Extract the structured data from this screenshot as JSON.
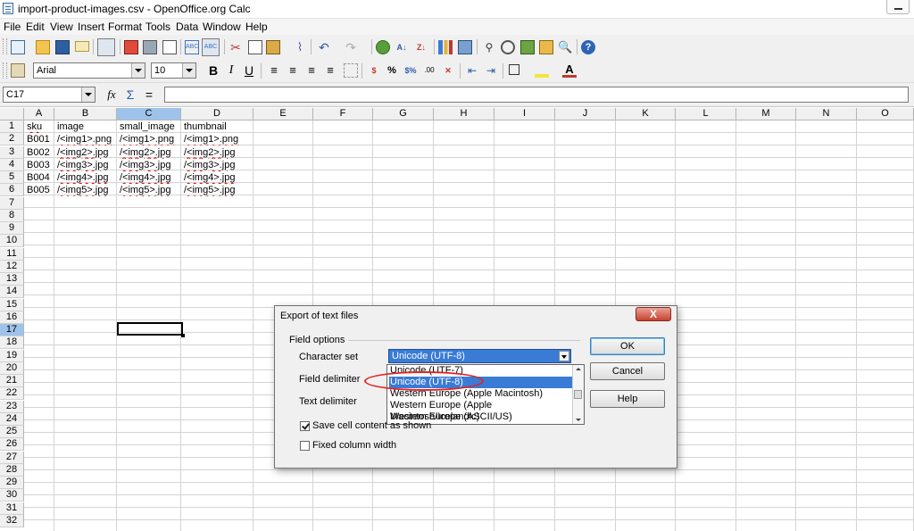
{
  "window": {
    "title": "import-product-images.csv - OpenOffice.org Calc"
  },
  "menu": [
    "File",
    "Edit",
    "View",
    "Insert",
    "Format",
    "Tools",
    "Data",
    "Window",
    "Help"
  ],
  "format_bar": {
    "font_name": "Arial",
    "font_size": "10"
  },
  "formula_bar": {
    "cell_ref": "C17",
    "content": ""
  },
  "sheet": {
    "columns": [
      "A",
      "B",
      "C",
      "D",
      "E",
      "F",
      "G",
      "H",
      "I",
      "J",
      "K",
      "L",
      "M",
      "N",
      "O"
    ],
    "selected_column": "C",
    "selected_row": "17",
    "rows": [
      "1",
      "2",
      "3",
      "4",
      "5",
      "6",
      "7",
      "8",
      "9",
      "10",
      "11",
      "12",
      "13",
      "14",
      "15",
      "16",
      "17",
      "18",
      "19",
      "20",
      "21",
      "22",
      "23",
      "24",
      "25",
      "26",
      "27",
      "28",
      "29",
      "30",
      "31",
      "32"
    ],
    "data": [
      [
        "sku",
        "image",
        "small_image",
        "thumbnail"
      ],
      [
        "B001",
        "/<img1>.png",
        "/<img1>.png",
        "/<img1>.png"
      ],
      [
        "B002",
        "/<img2>.jpg",
        "/<img2>.jpg",
        "/<img2>.jpg"
      ],
      [
        "B003",
        "/<img3>.jpg",
        "/<img3>.jpg",
        "/<img3>.jpg"
      ],
      [
        "B004",
        "/<img4>.jpg",
        "/<img4>.jpg",
        "/<img4>.jpg"
      ],
      [
        "B005",
        "/<img5>.jpg",
        "/<img5>.jpg",
        "/<img5>.jpg"
      ]
    ]
  },
  "dialog": {
    "title": "Export of text files",
    "close": "X",
    "group": "Field options",
    "character_set_label": "Character set",
    "field_delimiter_label": "Field delimiter",
    "text_delimiter_label": "Text delimiter",
    "character_set_value": "Unicode (UTF-8)",
    "options": [
      "Unicode (UTF-7)",
      "Unicode (UTF-8)",
      "Western Europe (Apple Macintosh)",
      "Western Europe (Apple Macintosh/Icelandic)",
      "Western Europe (ASCII/US)"
    ],
    "selected_option": 1,
    "save_as_shown_label": "Save cell content as shown",
    "save_as_shown_checked": true,
    "fixed_width_label": "Fixed column width",
    "fixed_width_checked": false,
    "ok": "OK",
    "cancel": "Cancel",
    "help": "Help"
  }
}
